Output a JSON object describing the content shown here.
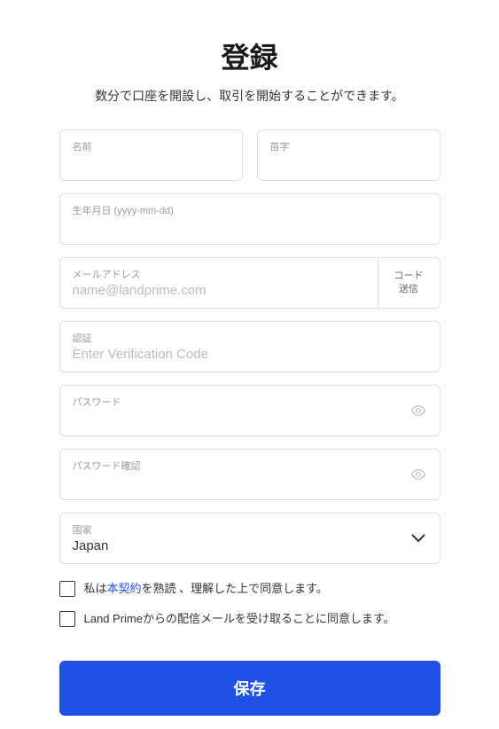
{
  "title": "登録",
  "subtitle": "数分で口座を開設し、取引を開始することができます。",
  "fields": {
    "firstName": {
      "label": "名前",
      "value": ""
    },
    "lastName": {
      "label": "苗字",
      "value": ""
    },
    "dob": {
      "label": "生年月日 (yyyy-mm-dd)",
      "value": ""
    },
    "email": {
      "label": "メールアドレス",
      "placeholder": "name@landprime.com",
      "value": ""
    },
    "sendCode": {
      "line1": "コード",
      "line2": "送信"
    },
    "verify": {
      "label": "認証",
      "placeholder": "Enter Verification Code",
      "value": ""
    },
    "password": {
      "label": "パスワード",
      "value": ""
    },
    "passwordConfirm": {
      "label": "パスワード確認",
      "value": ""
    },
    "country": {
      "label": "国家",
      "value": "Japan"
    }
  },
  "agreements": {
    "terms": {
      "prefix": "私は",
      "link": "本契約",
      "suffix": "を熟読 、理解した上で同意します。"
    },
    "marketing": "Land Primeからの配信メールを受け取ることに同意します。"
  },
  "submit": "保存"
}
